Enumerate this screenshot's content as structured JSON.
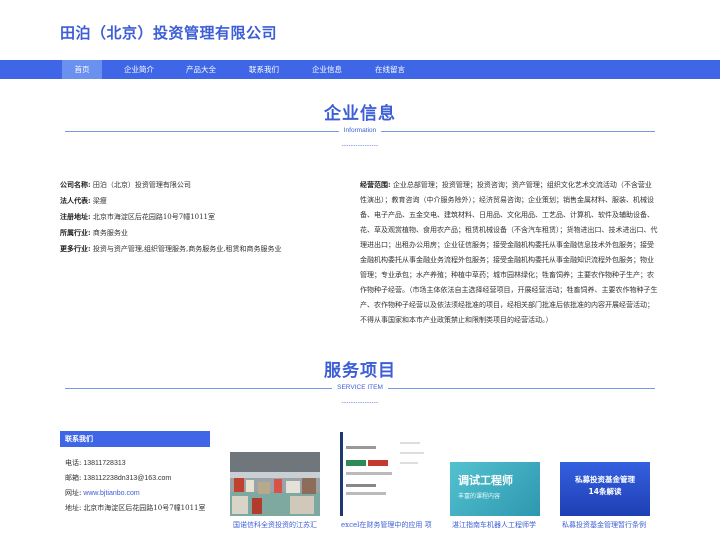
{
  "site": {
    "title": "田泊（北京）投资管理有限公司"
  },
  "nav": {
    "items": [
      {
        "label": "首页",
        "active": true
      },
      {
        "label": "企业简介"
      },
      {
        "label": "产品大全"
      },
      {
        "label": "联系我们"
      },
      {
        "label": "企业信息"
      },
      {
        "label": "在线留言"
      }
    ]
  },
  "company_section": {
    "title": "企业信息",
    "subtitle": "Information",
    "dashes": "----------------"
  },
  "company_info": {
    "name_label": "公司名称:",
    "name_value": "田泊（北京）投资管理有限公司",
    "rep_label": "法人代表:",
    "rep_value": "梁瘦",
    "addr_label": "注册地址:",
    "addr_value": "北京市海淀区后花园路10号7幢1011室",
    "industry_label": "所属行业:",
    "industry_value": "商务服务业",
    "more_label": "更多行业:",
    "more_value": "投资与资产管理,组织管理服务,商务服务业,租赁和商务服务业",
    "scope_label": "经营范围:",
    "scope_value": "企业总部管理；投资管理；投资咨询；资产管理；组织文化艺术交流活动（不含营业性演出）；教育咨询（中介服务除外）；经济贸易咨询；企业策划；销售金属材料、服装、机械设备、电子产品、五金交电、建筑材料、日用品、文化用品、工艺品、计算机、软件及辅助设备、花、草及观赏植物、食用农产品；租赁机械设备（不含汽车租赁）；货物进出口、技术进出口、代理进出口；出租办公用房；企业征信服务；接受金融机构委托从事金融信息技术外包服务；接受金融机构委托从事金融业务流程外包服务；接受金融机构委托从事金融知识流程外包服务；物业管理；专业承包；水产养殖；种植中草药；城市园林绿化；牲畜饲养；主要农作物种子生产；农作物种子经营。（市场主体依法自主选择经营项目，开展经营活动；牲畜饲养、主要农作物种子生产、农作物种子经营以及依法须经批准的项目，经相关部门批准后依批准的内容开展经营活动；不得从事国家和本市产业政策禁止和限制类项目的经营活动。）"
  },
  "service_section": {
    "title": "服务项目",
    "subtitle": "SERVICE ITEM",
    "dashes": "----------------"
  },
  "contact": {
    "title": "联系我们",
    "phone_label": "电话:",
    "phone_value": "13811728313",
    "email_label": "邮箱:",
    "email_value": "138112238dn313@163.com",
    "web_label": "网址:",
    "web_value": "www.bjtianbo.com",
    "addr_label": "地址:",
    "addr_value": "北京市海淀区后花园路10号7幢1011室"
  },
  "services": [
    {
      "caption": "国诺信科全资投资的江苏汇",
      "image_text": ""
    },
    {
      "caption": "excel在财务管理中的应用 项",
      "image_text": ""
    },
    {
      "caption": "湛江指南车机器人工程师学",
      "image_text": "调试工程师",
      "image_subtext": "丰富的课程内容"
    },
    {
      "caption": "私募投资基金管理暂行条例",
      "image_text": "私募投资基金管理",
      "image_subtext": "14条解读"
    }
  ],
  "colors": {
    "accent": "#3f66e6",
    "title": "#3d5ed6"
  }
}
